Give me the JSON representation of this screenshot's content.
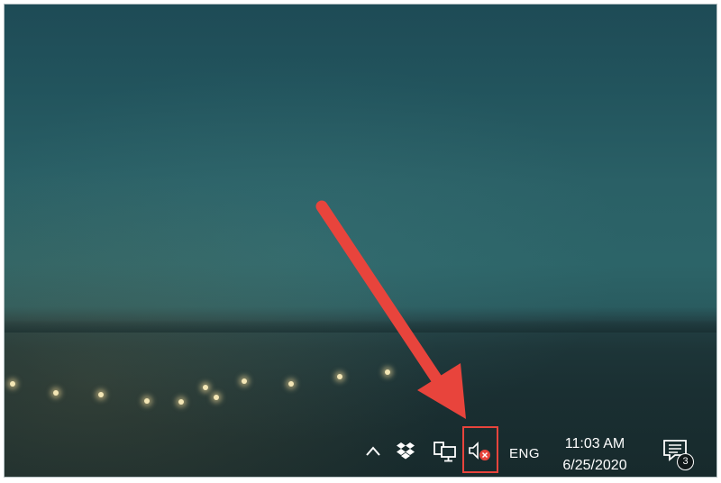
{
  "taskbar": {
    "tray_icons": [
      "chevron-up-icon",
      "dropbox-icon",
      "network-icon",
      "volume-muted-icon"
    ],
    "language": "ENG",
    "clock": {
      "time": "11:03 AM",
      "date": "6/25/2020"
    },
    "notifications": {
      "count": "3"
    }
  },
  "annotation": {
    "arrow_color": "#e8443c",
    "highlight_color": "#e8443c"
  }
}
